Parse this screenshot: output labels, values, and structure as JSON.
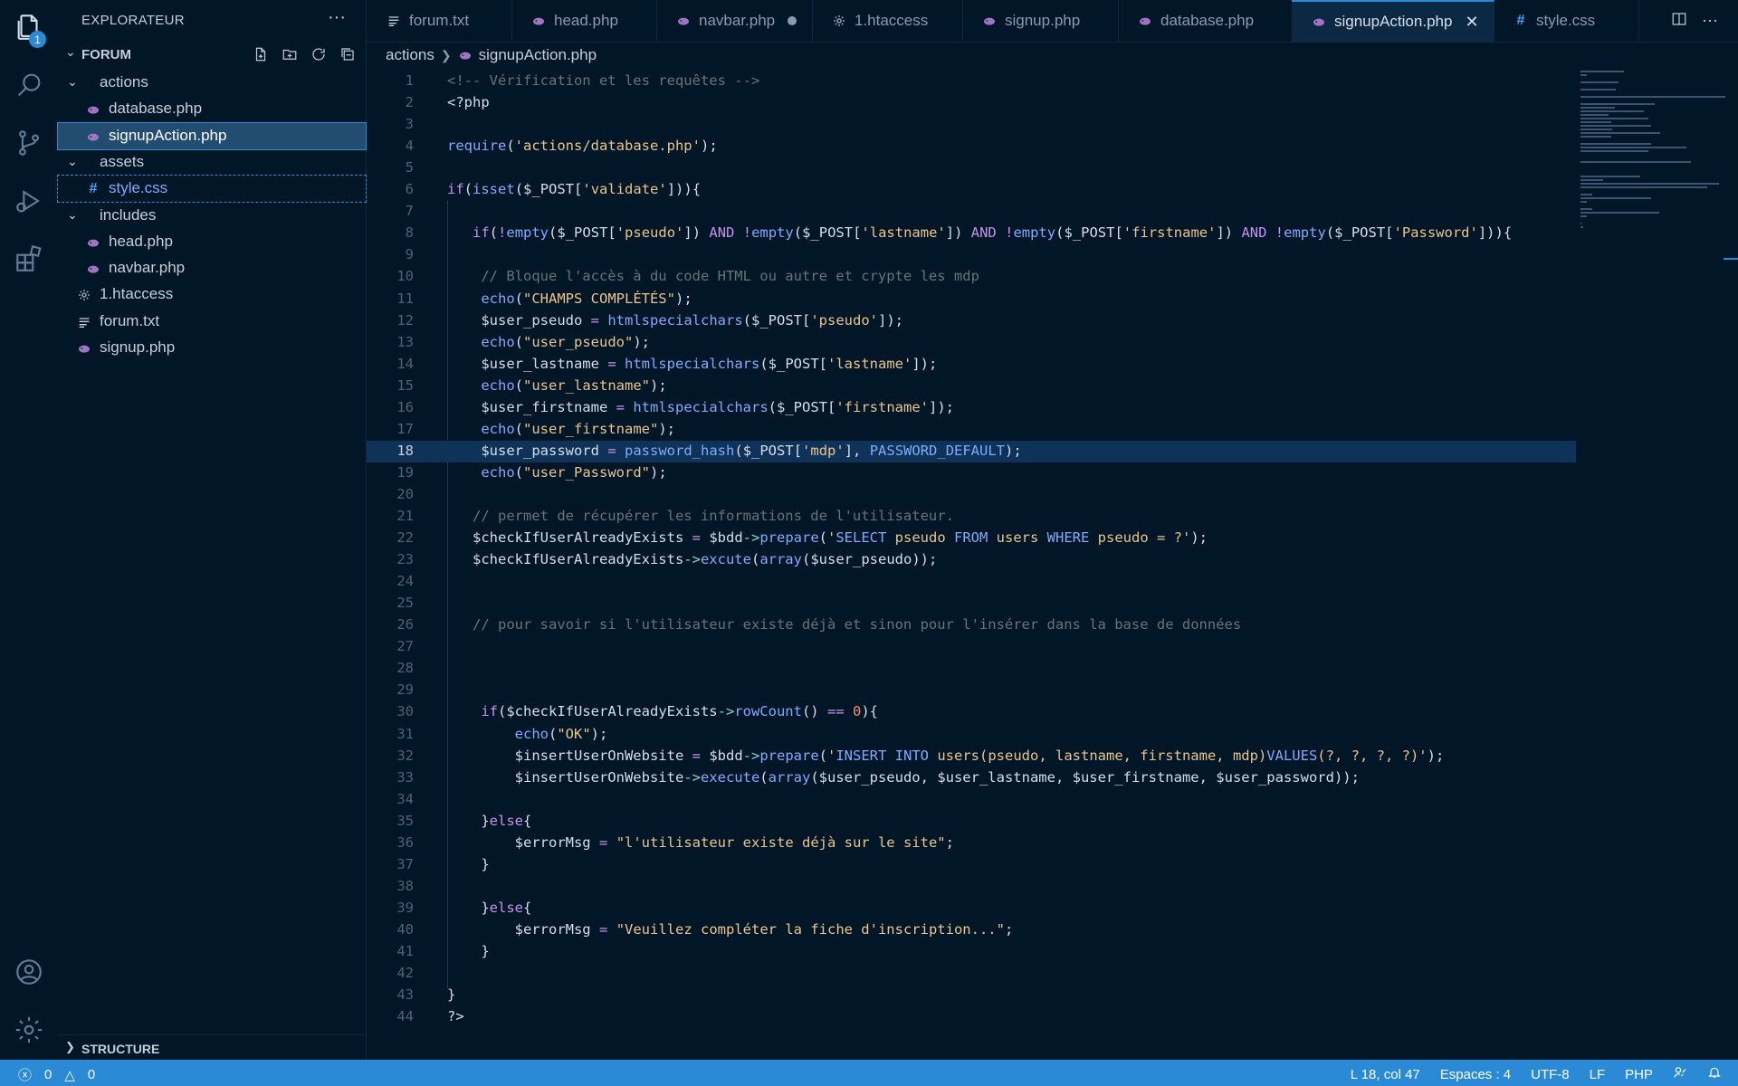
{
  "activity_bar": {
    "icons": [
      "files-icon",
      "search-icon",
      "source-control-icon",
      "run-debug-icon",
      "extensions-icon",
      "account-icon",
      "settings-gear-icon"
    ],
    "explorer_badge": "1"
  },
  "sidebar": {
    "header": "EXPLORATEUR",
    "more": "···",
    "root": "FORUM",
    "items": [
      {
        "label": "actions",
        "kind": "folder",
        "depth": 1
      },
      {
        "label": "database.php",
        "kind": "php",
        "depth": 2
      },
      {
        "label": "signupAction.php",
        "kind": "php",
        "depth": 2
      },
      {
        "label": "assets",
        "kind": "folder",
        "depth": 1
      },
      {
        "label": "style.css",
        "kind": "css",
        "depth": 2
      },
      {
        "label": "includes",
        "kind": "folder",
        "depth": 1
      },
      {
        "label": "head.php",
        "kind": "php",
        "depth": 2
      },
      {
        "label": "navbar.php",
        "kind": "php",
        "depth": 2
      },
      {
        "label": "1.htaccess",
        "kind": "gear",
        "depth": 1
      },
      {
        "label": "forum.txt",
        "kind": "txt",
        "depth": 1
      },
      {
        "label": "signup.php",
        "kind": "php",
        "depth": 1
      }
    ],
    "structure": "STRUCTURE"
  },
  "tabs": [
    {
      "label": "forum.txt",
      "kind": "txt"
    },
    {
      "label": "head.php",
      "kind": "php"
    },
    {
      "label": "navbar.php",
      "kind": "php",
      "modified": true
    },
    {
      "label": "1.htaccess",
      "kind": "gear"
    },
    {
      "label": "signup.php",
      "kind": "php"
    },
    {
      "label": "database.php",
      "kind": "php"
    },
    {
      "label": "signupAction.php",
      "kind": "php",
      "active": true
    },
    {
      "label": "style.css",
      "kind": "css"
    }
  ],
  "breadcrumb": {
    "folder": "actions",
    "file": "signupAction.php"
  },
  "code_lines": [
    "<!-- Vérification et les requêtes -->",
    "<?php",
    "",
    "require('actions/database.php');",
    "",
    "if(isset($_POST['validate'])){",
    "",
    "   if(!empty($_POST['pseudo']) AND !empty($_POST['lastname']) AND !empty($_POST['firstname']) AND !empty($_POST['Password'])){",
    "",
    "    // Bloque l'accès à du code HTML ou autre et crypte les mdp",
    "    echo(\"CHAMPS COMPLÉTÉS\");",
    "    $user_pseudo = htmlspecialchars($_POST['pseudo']);",
    "    echo(\"user_pseudo\");",
    "    $user_lastname = htmlspecialchars($_POST['lastname']);",
    "    echo(\"user_lastname\");",
    "    $user_firstname = htmlspecialchars($_POST['firstname']);",
    "    echo(\"user_firstname\");",
    "    $user_password = password_hash($_POST['mdp'], PASSWORD_DEFAULT);",
    "    echo(\"user_Password\");",
    "",
    "   // permet de récupérer les informations de l'utilisateur.",
    "   $checkIfUserAlreadyExists = $bdd->prepare('SELECT pseudo FROM users WHERE pseudo = ?');",
    "   $checkIfUserAlreadyExists->excute(array($user_pseudo));",
    "",
    "",
    "   // pour savoir si l'utilisateur existe déjà et sinon pour l'insérer dans la base de données",
    "",
    "",
    "",
    "    if($checkIfUserAlreadyExists->rowCount() == 0){",
    "        echo(\"OK\");",
    "        $insertUserOnWebsite = $bdd->prepare('INSERT INTO users(pseudo, lastname, firstname, mdp)VALUES(?, ?, ?, ?)');",
    "        $insertUserOnWebsite->execute(array($user_pseudo, $user_lastname, $user_firstname, $user_password));",
    "",
    "    }else{",
    "        $errorMsg = \"l'utilisateur existe déjà sur le site\";",
    "    }",
    "",
    "    }else{",
    "        $errorMsg = \"Veuillez compléter la fiche d'inscription...\";",
    "    }",
    "",
    "}",
    "?>"
  ],
  "current_line": 18,
  "statusbar": {
    "errors": "0",
    "warnings": "0",
    "position": "L 18, col 47",
    "spaces": "Espaces : 4",
    "encoding": "UTF-8",
    "eol": "LF",
    "language": "PHP"
  },
  "colors": {
    "background": "#011627",
    "accent": "#2a8ad6",
    "php_icon": "#a074c4",
    "css_icon": "#42a5f5"
  }
}
